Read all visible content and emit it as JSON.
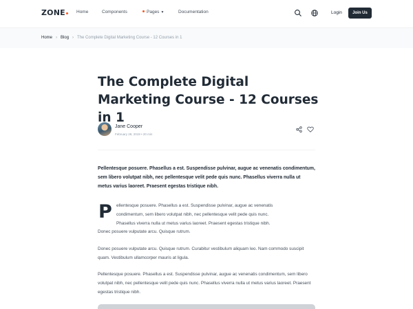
{
  "header": {
    "logo": "ZONE",
    "nav": [
      "Home",
      "Components",
      "Pages",
      "Documentation"
    ],
    "login_label": "Login",
    "join_label": "Join Us",
    "accent_color": "#fa541c",
    "icons": [
      "search-icon",
      "globe-icon"
    ]
  },
  "breadcrumb": {
    "items": [
      "Home",
      "Blog"
    ],
    "current": "The Complete Digital Marketing Course - 12 Courses in 1"
  },
  "article": {
    "title": "The Complete Digital Marketing Course - 12 Courses in 1",
    "author": {
      "name": "Jane Cooper",
      "meta": "February 28, 2019 • 20 min"
    },
    "actions": [
      "share-icon",
      "heart-icon"
    ],
    "lead": "Pellentesque posuere. Phasellus a est. Suspendisse pulvinar, augue ac venenatis condimentum, sem libero volutpat nibh, nec pellentesque velit pede quis nunc. Phasellus viverra nulla ut metus varius laoreet. Praesent egestas tristique nibh.",
    "dropcap": "P",
    "paragraph1": {
      "line1": "ellentesque posuere. Phasellus a est. Suspendisse pulvinar, augue ac venenatis",
      "line2": "condimentum, sem libero volutpat nibh, nec pellentesque velit pede quis nunc.",
      "line3": "Phasellus viverra nulla ut metus varius laoreet. Praesent egestas tristique nibh.",
      "line4": "Donec posuere vulputate arcu. Quisque rutrum."
    },
    "paragraph2": "Donec posuere vulputate arcu. Quisque rutrum. Curabitur vestibulum aliquam leo. Nam commodo suscipit quam. Vestibulum ullamcorper mauris at ligula.",
    "paragraph3": "Pellentesque posuere. Phasellus a est. Suspendisse pulvinar, augue ac venenatis condimentum, sem libero volutpat nibh, nec pellentesque velit pede quis nunc. Phasellus viverra nulla ut metus varius laoreet. Praesent egestas tristique nibh."
  }
}
